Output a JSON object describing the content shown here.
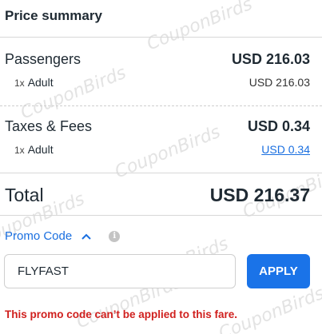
{
  "watermark_text": "CouponBirds",
  "price_summary": {
    "title": "Price summary",
    "passengers": {
      "label": "Passengers",
      "amount": "USD 216.03",
      "sub_qty": "1x",
      "sub_label": "Adult",
      "sub_amount": "USD 216.03"
    },
    "taxes": {
      "label": "Taxes & Fees",
      "amount": "USD 0.34",
      "sub_qty": "1x",
      "sub_label": "Adult",
      "sub_amount": "USD 0.34"
    },
    "total": {
      "label": "Total",
      "amount": "USD 216.37"
    }
  },
  "promo": {
    "toggle_label": "Promo Code",
    "toggle_icon": "chevron-up-icon",
    "info_icon": "info-icon",
    "input_value": "FLYFAST",
    "apply_label": "APPLY",
    "error": "This promo code can’t be applied to this fare."
  },
  "colors": {
    "link": "#1a6fe0",
    "button": "#1a73e8",
    "error": "#d0201e"
  }
}
